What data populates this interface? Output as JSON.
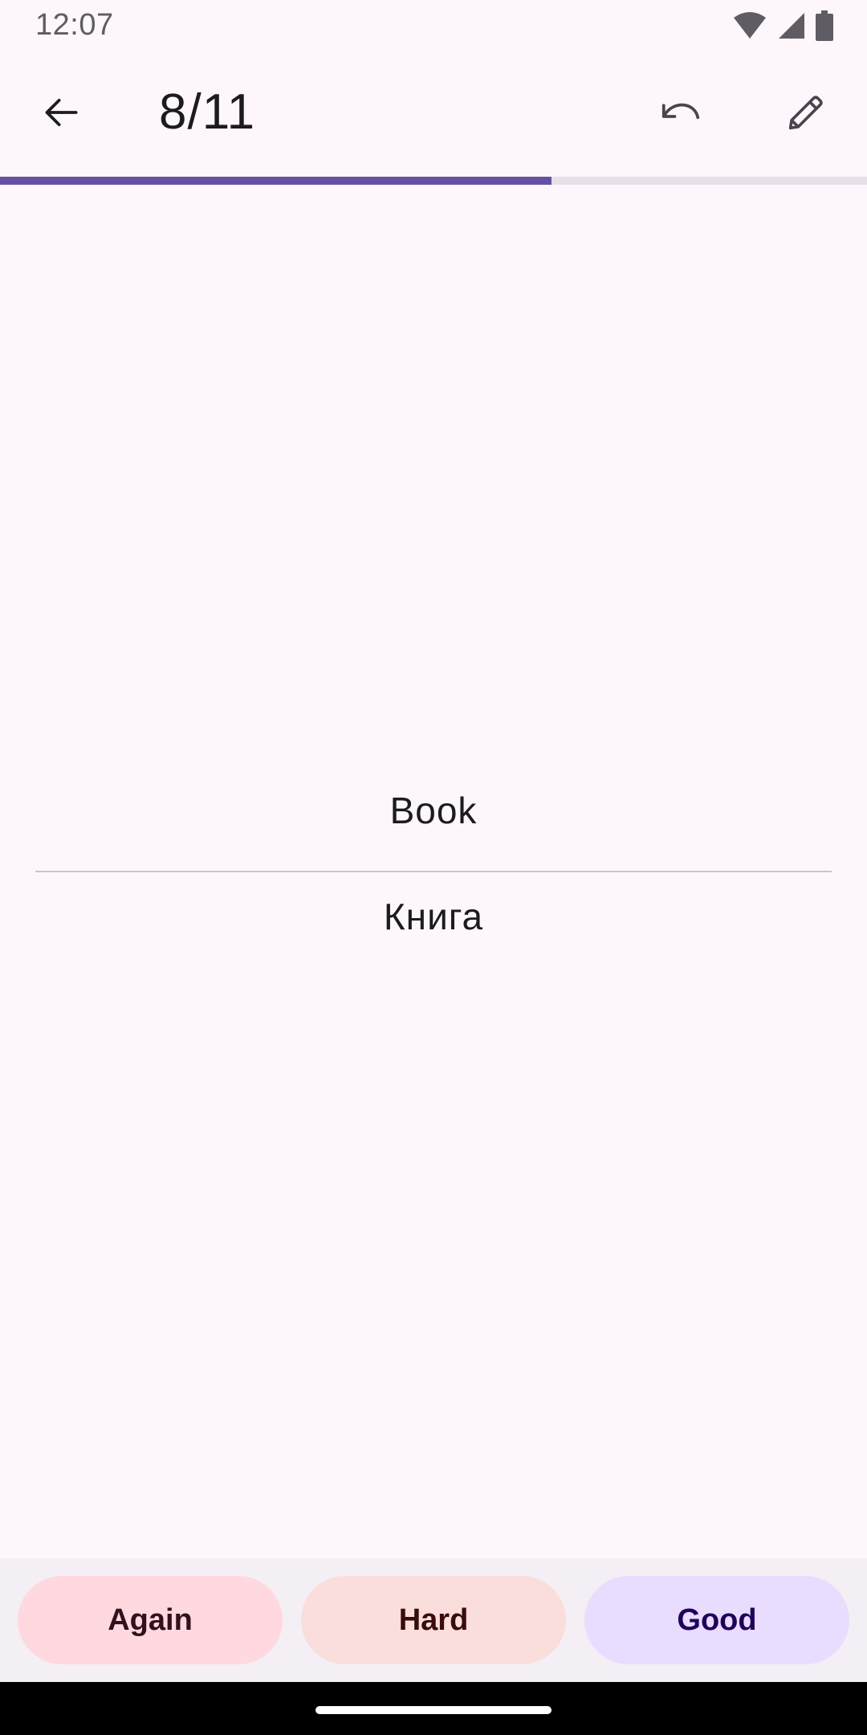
{
  "status_bar": {
    "time": "12:07",
    "icons": [
      "wifi-icon",
      "cellular-signal-icon",
      "battery-icon"
    ]
  },
  "app_bar": {
    "back_icon": "arrow-back-icon",
    "counter": "8/11",
    "undo_icon": "undo-icon",
    "edit_icon": "pencil-icon"
  },
  "progress": {
    "current": 8,
    "total": 11,
    "fraction": 0.636,
    "fill_color": "#6750A4",
    "track_color": "#E6E0E9"
  },
  "card": {
    "front": "Book",
    "back": "Книга"
  },
  "answers": {
    "again": "Again",
    "hard": "Hard",
    "good": "Good"
  },
  "colors": {
    "background": "#FDF7FC",
    "again_bg": "#FFD9DF",
    "hard_bg": "#F9DEDB",
    "good_bg": "#E8DDFF"
  }
}
